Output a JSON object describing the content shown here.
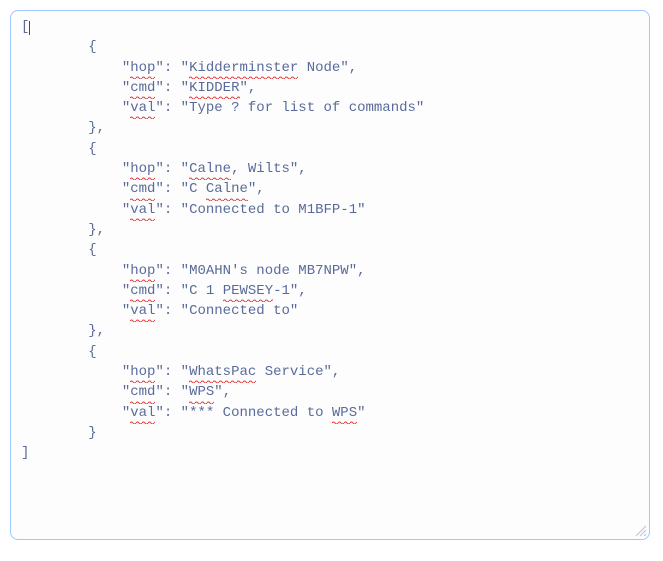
{
  "code": {
    "opening_bracket": "[",
    "closing_bracket": "]",
    "entry_open": "{",
    "entry_close": "},",
    "entry_close_last": "}",
    "hop_key_open": "\"",
    "hop_key_word": "hop",
    "cmd_key_word": "cmd",
    "val_key_word": "val",
    "key_close": "\": ",
    "str_open": "\"",
    "str_close": "\",",
    "str_close_last": "\"",
    "entries": [
      {
        "hop_pre": "",
        "hop_sq": "Kidderminster",
        "hop_post": " Node",
        "cmd_pre": "",
        "cmd_sq": "KIDDER",
        "cmd_post": "",
        "val_text": "Type ? for list of commands",
        "val_sq": "",
        "val_post": ""
      },
      {
        "hop_pre": "",
        "hop_sq": "Calne",
        "hop_post": ", Wilts",
        "cmd_pre": "C ",
        "cmd_sq": "Calne",
        "cmd_post": "",
        "val_text": "Connected to M1BFP-1",
        "val_sq": "",
        "val_post": ""
      },
      {
        "hop_pre": "M0AHN's node MB7NPW",
        "hop_sq": "",
        "hop_post": "",
        "cmd_pre": "C 1 ",
        "cmd_sq": "PEWSEY",
        "cmd_post": "-1",
        "val_text": "Connected to",
        "val_sq": "",
        "val_post": ""
      },
      {
        "hop_pre": "",
        "hop_sq": "WhatsPac",
        "hop_post": " Service",
        "cmd_pre": "",
        "cmd_sq": "WPS",
        "cmd_post": "",
        "val_text": "*** Connected to ",
        "val_sq": "WPS",
        "val_post": ""
      }
    ]
  }
}
